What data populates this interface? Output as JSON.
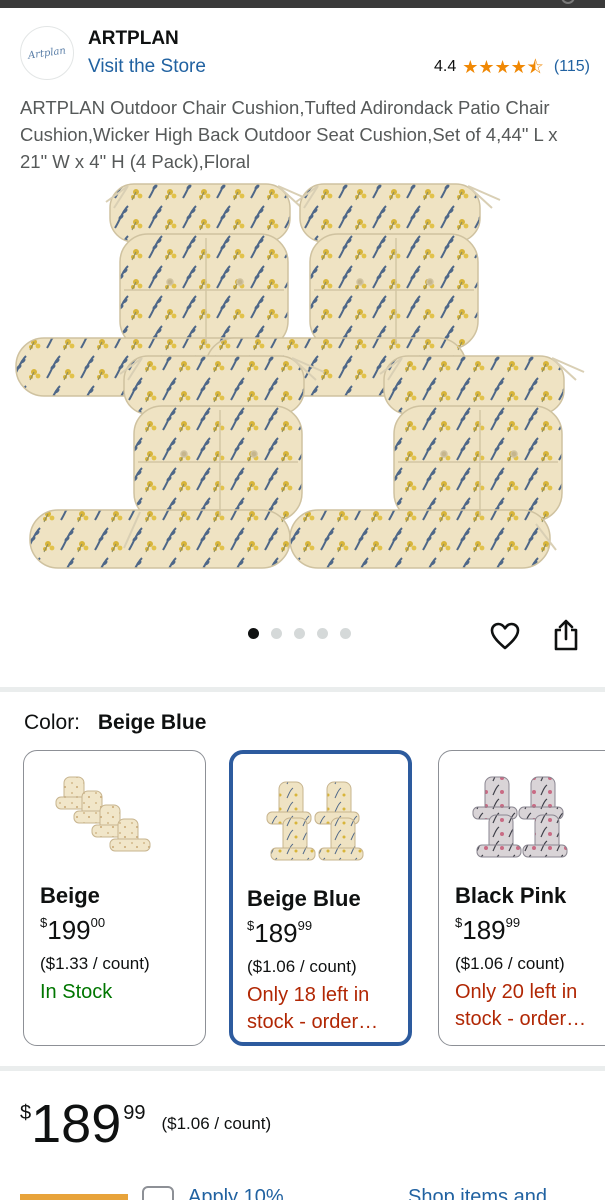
{
  "brand": {
    "name": "ARTPLAN",
    "logo_text": "Artplan",
    "visit_store": "Visit the Store",
    "rating_value": "4.4",
    "rating_stars": 4.4,
    "review_count": "(115)"
  },
  "product": {
    "title": "ARTPLAN Outdoor Chair Cushion,Tufted Adirondack Patio Chair Cushion,Wicker High Back Outdoor Seat Cushion,Set of 4,44\" L x 21\" W x 4\" H (4 Pack),Floral",
    "image_count": 5,
    "active_image": 1
  },
  "icons": {
    "wishlist": "heart-icon",
    "share": "share-icon",
    "star": "star-icon"
  },
  "color_selector": {
    "label": "Color:",
    "selected": "Beige Blue",
    "options": [
      {
        "name": "Beige",
        "price_whole": "199",
        "price_fraction": "00",
        "currency": "$",
        "unit_price": "($1.33 / count)",
        "availability": "In Stock",
        "selected": false,
        "swatch_color": "#f2e6c6"
      },
      {
        "name": "Beige Blue",
        "price_whole": "189",
        "price_fraction": "99",
        "currency": "$",
        "unit_price": "($1.06 / count)",
        "availability": "Only 18 left in stock - order…",
        "selected": true,
        "swatch_color": "#ece3c8"
      },
      {
        "name": "Black Pink",
        "price_whole": "189",
        "price_fraction": "99",
        "currency": "$",
        "unit_price": "($1.06 / count)",
        "availability": "Only 20 left in stock - order…",
        "selected": false,
        "swatch_color": "#9a9aa4"
      }
    ]
  },
  "price": {
    "currency": "$",
    "whole": "189",
    "fraction": "99",
    "unit_price": "($1.06 / count)"
  },
  "bottom_peek": {
    "coupon_text": "Apply 10%",
    "right_text": "Shop items and"
  },
  "colors": {
    "link": "#2162a1",
    "star": "#f08804",
    "in_stock": "#007600",
    "low_stock": "#b12704",
    "selected_border": "#2d5b9e"
  }
}
